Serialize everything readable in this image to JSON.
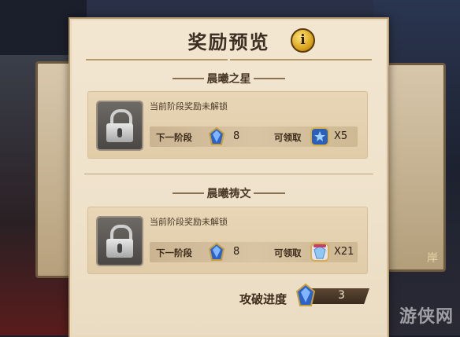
{
  "panel": {
    "title": "奖励预览",
    "info_label": "i"
  },
  "sections": [
    {
      "name": "晨曦之星",
      "status_text": "当前阶段奖励未解锁",
      "next_stage_label": "下一阶段",
      "next_stage_value": "8",
      "claimable_label": "可领取",
      "reward_count": "X5"
    },
    {
      "name": "晨曦祷文",
      "status_text": "当前阶段奖励未解锁",
      "next_stage_label": "下一阶段",
      "next_stage_value": "8",
      "claimable_label": "可领取",
      "reward_count": "X21"
    }
  ],
  "progress": {
    "label": "攻破进度",
    "value": "3"
  },
  "background": {
    "right_label": "岸"
  },
  "watermark": "游侠网",
  "colors": {
    "panel_bg": "#f2e6d1",
    "card_bg": "#e4d0ad",
    "gold": "#d69f17"
  }
}
